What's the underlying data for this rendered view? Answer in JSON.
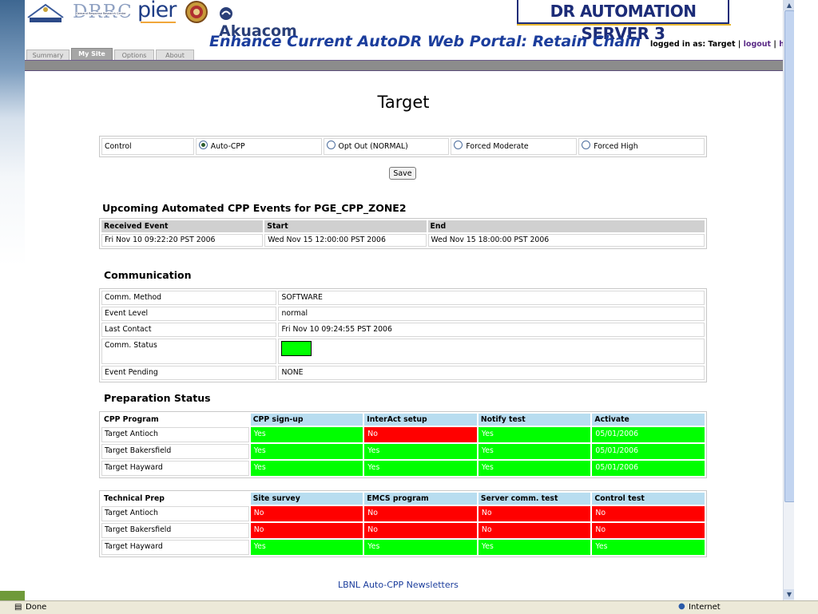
{
  "browser": {
    "status_text": "Done",
    "zone_text": "Internet",
    "colors": {
      "status_bg": "#ece9d8",
      "scroll_thumb": "#c2d4f0"
    }
  },
  "header": {
    "logos": {
      "drrc": "DRRC",
      "drrc_sub": "Demand Response Research Center",
      "pier": "pier",
      "akuacom": "Akuacom",
      "dr_automation": "DR AUTOMATION SERVER 3"
    },
    "slide_title": "Enhance Current AutoDR Web Portal: Retain Chain",
    "login_prefix": "logged in as: Target |",
    "logout_label": "logout",
    "separator": "|",
    "help_label": "help",
    "tabs": [
      {
        "label": "Summary"
      },
      {
        "label": "My Site"
      },
      {
        "label": "Options"
      },
      {
        "label": "About"
      }
    ]
  },
  "page": {
    "title": "Target",
    "control": {
      "label": "Control",
      "options": [
        {
          "label": "Auto-CPP",
          "selected": true
        },
        {
          "label": "Opt Out (NORMAL)",
          "selected": false
        },
        {
          "label": "Forced Moderate",
          "selected": false
        },
        {
          "label": "Forced High",
          "selected": false
        }
      ]
    },
    "save_label": "Save",
    "events": {
      "heading": "Upcoming Automated CPP Events for PGE_CPP_ZONE2",
      "columns": [
        "Received Event",
        "Start",
        "End"
      ],
      "rows": [
        [
          "Fri Nov 10 09:22:20 PST 2006",
          "Wed Nov 15 12:00:00 PST 2006",
          "Wed Nov 15 18:00:00 PST 2006"
        ]
      ]
    },
    "communication": {
      "heading": "Communication",
      "rows": [
        {
          "label": "Comm. Method",
          "value": "SOFTWARE"
        },
        {
          "label": "Event Level",
          "value": "normal"
        },
        {
          "label": "Last Contact",
          "value": "Fri Nov 10 09:24:55 PST 2006"
        },
        {
          "label": "Comm. Status",
          "value": "",
          "status_color": "#00ff00"
        },
        {
          "label": "Event Pending",
          "value": "NONE"
        }
      ]
    },
    "preparation": {
      "heading": "Preparation Status",
      "cpp_program": {
        "columns": [
          "CPP Program",
          "CPP sign-up",
          "InterAct setup",
          "Notify test",
          "Activate"
        ],
        "rows": [
          [
            "Target Antioch",
            "Yes",
            "No",
            "Yes",
            "05/01/2006"
          ],
          [
            "Target Bakersfield",
            "Yes",
            "Yes",
            "Yes",
            "05/01/2006"
          ],
          [
            "Target Hayward",
            "Yes",
            "Yes",
            "Yes",
            "05/01/2006"
          ]
        ]
      },
      "technical_prep": {
        "columns": [
          "Technical Prep",
          "Site survey",
          "EMCS program",
          "Server comm. test",
          "Control test"
        ],
        "rows": [
          [
            "Target Antioch",
            "No",
            "No",
            "No",
            "No"
          ],
          [
            "Target Bakersfield",
            "No",
            "No",
            "No",
            "No"
          ],
          [
            "Target Hayward",
            "Yes",
            "Yes",
            "Yes",
            "Yes"
          ]
        ]
      },
      "colors": {
        "yes": "#00ff00",
        "no": "#ff0000",
        "header": "#b8ddf0"
      }
    },
    "newsletter_link": "LBNL Auto-CPP Newsletters"
  }
}
